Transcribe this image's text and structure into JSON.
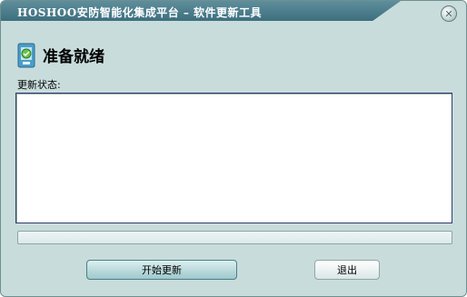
{
  "window": {
    "title": "HOSHOO安防智能化集成平台  –  软件更新工具",
    "close_glyph": "✕"
  },
  "header": {
    "heading": "准备就绪",
    "icon": "app-update-icon"
  },
  "status": {
    "label": "更新状态:",
    "log_text": "",
    "progress_percent": 0
  },
  "buttons": {
    "start_label": "开始更新",
    "exit_label": "退出"
  },
  "colors": {
    "title_bar": "#4a7d8c",
    "window_bg": "#c9dcdc",
    "status_border": "#2f3d6b"
  }
}
